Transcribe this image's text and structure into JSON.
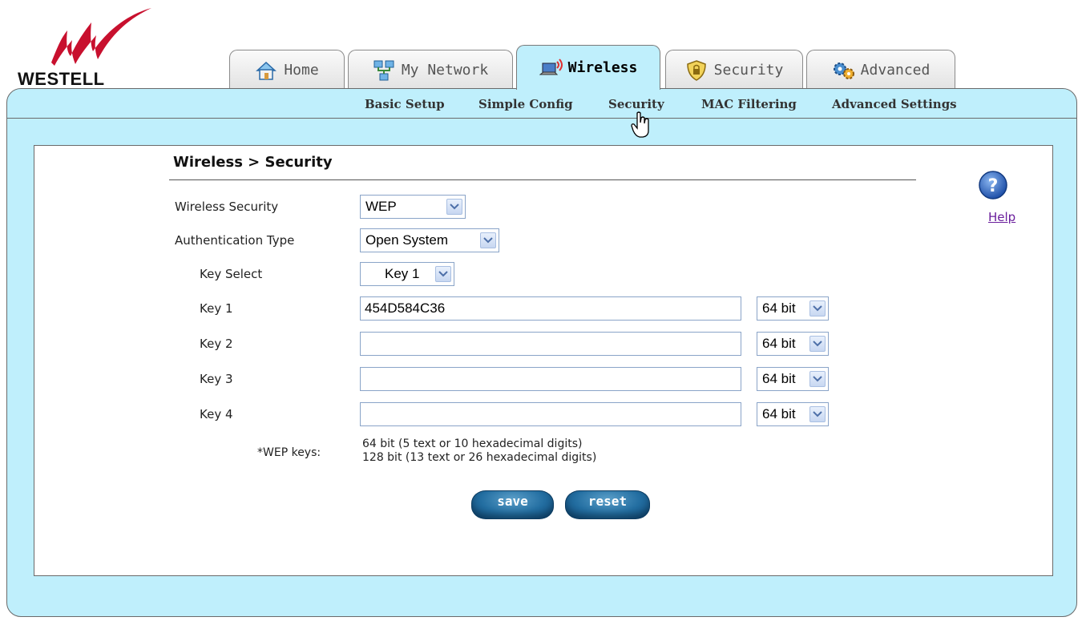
{
  "brand": {
    "name": "WESTELL"
  },
  "tabs": [
    {
      "label": "Home",
      "icon": "home-icon"
    },
    {
      "label": "My Network",
      "icon": "network-icon"
    },
    {
      "label": "Wireless",
      "icon": "wireless-laptop-icon",
      "active": true
    },
    {
      "label": "Security",
      "icon": "shield-icon"
    },
    {
      "label": "Advanced",
      "icon": "gears-icon"
    }
  ],
  "subnav": [
    {
      "label": "Basic Setup"
    },
    {
      "label": "Simple Config"
    },
    {
      "label": "Security",
      "active": true
    },
    {
      "label": "MAC Filtering"
    },
    {
      "label": "Advanced Settings"
    }
  ],
  "page": {
    "title": "Wireless > Security",
    "help_label": "Help"
  },
  "form": {
    "wireless_security": {
      "label": "Wireless Security",
      "value": "WEP"
    },
    "auth_type": {
      "label": "Authentication Type",
      "value": "Open System"
    },
    "key_select": {
      "label": "Key Select",
      "value": "Key 1"
    },
    "keys": [
      {
        "label": "Key 1",
        "value": "454D584C36",
        "size": "64 bit"
      },
      {
        "label": "Key 2",
        "value": "",
        "size": "64 bit"
      },
      {
        "label": "Key 3",
        "value": "",
        "size": "64 bit"
      },
      {
        "label": "Key 4",
        "value": "",
        "size": "64 bit"
      }
    ],
    "wep_note_label": "*WEP keys:",
    "wep_note_line1": "64 bit (5 text or 10 hexadecimal digits)",
    "wep_note_line2": "128 bit (13 text or 26 hexadecimal digits)"
  },
  "buttons": {
    "save": "save",
    "reset": "reset"
  },
  "colors": {
    "panel_bg": "#bfeffc",
    "button_blue": "#236ea1",
    "logo_red": "#c8102e",
    "help_link": "#6a1e9c"
  }
}
